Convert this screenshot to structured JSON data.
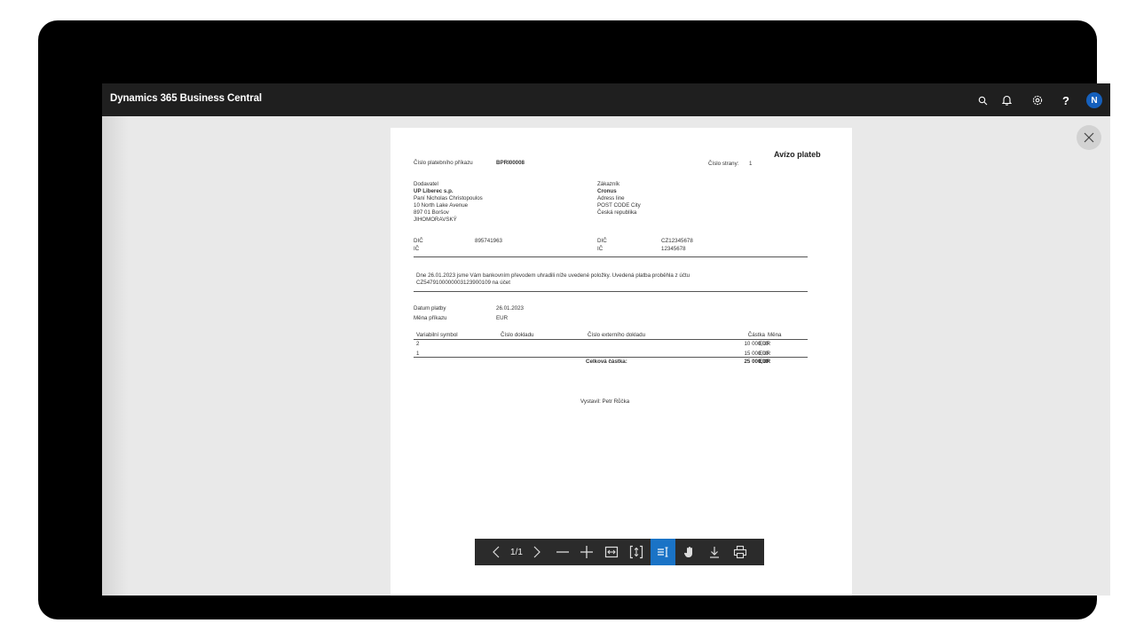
{
  "app": {
    "title": "Dynamics 365 Business Central",
    "user_initial": "N"
  },
  "topbar": {
    "icons": [
      "search-icon",
      "bell-icon",
      "gear-icon",
      "help-icon"
    ],
    "help_label": "?"
  },
  "report": {
    "title": "Avízo plateb",
    "order_label": "Číslo platebního příkazu",
    "order_no": "BPRI00008",
    "page_label": "Číslo strany:",
    "page_no": "1",
    "supplier": {
      "heading": "Dodavatel",
      "name": "UP Liberec s.p.",
      "contact": "Paní Nicholas Christopoulos",
      "address1": "10 North Lake Avenue",
      "address2": "897 01 Boršov",
      "region": "JIHOMORAVSKÝ",
      "vat_label": "DIČ",
      "vat": "895741963",
      "reg_label": "IČ",
      "reg": ""
    },
    "customer": {
      "heading": "Zákazník",
      "name": "Cronus",
      "address1": "Adress line",
      "address2": "POST CODE City",
      "country": "Česká republika",
      "vat_label": "DIČ",
      "vat": "CZ12345678",
      "reg_label": "IČ",
      "reg": "12345678"
    },
    "message_line1": "Dne 26.01.2023 jsme Vám bankovním převodem uhradili níže uvedené položky. Uvedená platba proběhla z účtu",
    "message_line2": "CZ5479100000003123900109 na účet",
    "payment_date_label": "Datum platby",
    "payment_date": "26.01.2023",
    "currency_label": "Měna příkazu",
    "currency": "EUR",
    "table": {
      "headers": [
        "Variabilní symbol",
        "Číslo dokladu",
        "Číslo externího dokladu",
        "Částka",
        "Měna"
      ],
      "rows": [
        {
          "vs": "2",
          "doc": "",
          "ext": "",
          "amount": "10 000,00",
          "cur": "EUR"
        },
        {
          "vs": "1",
          "doc": "",
          "ext": "",
          "amount": "15 000,00",
          "cur": "EUR"
        }
      ],
      "total_label": "Celková částka:",
      "total_amount": "25 000,00",
      "total_currency": "EUR"
    },
    "issued_by": "Vystavil: Petr Růčka"
  },
  "viewer": {
    "page_indicator": "1/1",
    "buttons": [
      "prev-page",
      "next-page",
      "zoom-out",
      "zoom-in",
      "fit-width",
      "fit-page",
      "text-select",
      "pan",
      "download",
      "print"
    ],
    "active": "text-select"
  },
  "colors": {
    "topbar": "#1f1f1f",
    "accent": "#1a73c6",
    "avatar": "#1560bd"
  }
}
